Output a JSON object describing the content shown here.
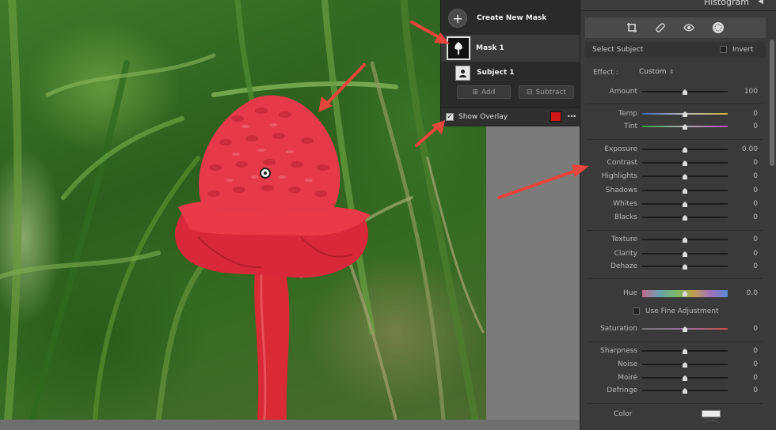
{
  "histogram": {
    "title": "Histogram"
  },
  "mask_panel": {
    "create_new_mask": "Create New Mask",
    "mask_name": "Mask 1",
    "subject_name": "Subject 1",
    "add_label": "Add",
    "subtract_label": "Subtract",
    "show_overlay_label": "Show Overlay",
    "overlay_checked": true,
    "overlay_color": "#d01818",
    "more_label": "•••"
  },
  "panel": {
    "select_subject": "Select Subject",
    "invert_label": "Invert",
    "effect_label": "Effect :",
    "effect_value": "Custom",
    "use_fine_adjustment": "Use Fine Adjustment",
    "color_label": "Color"
  },
  "sliders": [
    {
      "label": "Amount",
      "value": "100",
      "pos": 0.5,
      "style": "plain"
    },
    {
      "label": "Temp",
      "value": "0",
      "pos": 0.5,
      "style": "temp"
    },
    {
      "label": "Tint",
      "value": "0",
      "pos": 0.5,
      "style": "tint"
    },
    {
      "label": "Exposure",
      "value": "0.00",
      "pos": 0.5,
      "style": "plain"
    },
    {
      "label": "Contrast",
      "value": "0",
      "pos": 0.5,
      "style": "plain"
    },
    {
      "label": "Highlights",
      "value": "0",
      "pos": 0.5,
      "style": "plain"
    },
    {
      "label": "Shadows",
      "value": "0",
      "pos": 0.5,
      "style": "plain"
    },
    {
      "label": "Whites",
      "value": "0",
      "pos": 0.5,
      "style": "plain"
    },
    {
      "label": "Blacks",
      "value": "0",
      "pos": 0.5,
      "style": "plain"
    },
    {
      "label": "Texture",
      "value": "0",
      "pos": 0.5,
      "style": "plain"
    },
    {
      "label": "Clarity",
      "value": "0",
      "pos": 0.5,
      "style": "plain"
    },
    {
      "label": "Dehaze",
      "value": "0",
      "pos": 0.5,
      "style": "plain"
    },
    {
      "label": "Hue",
      "value": "0.0",
      "pos": 0.5,
      "style": "hue"
    },
    {
      "label": "Saturation",
      "value": "0",
      "pos": 0.5,
      "style": "saturation"
    },
    {
      "label": "Sharpness",
      "value": "0",
      "pos": 0.5,
      "style": "plain"
    },
    {
      "label": "Noise",
      "value": "0",
      "pos": 0.5,
      "style": "plain"
    },
    {
      "label": "Moiré",
      "value": "0",
      "pos": 0.5,
      "style": "plain"
    },
    {
      "label": "Defringe",
      "value": "0",
      "pos": 0.5,
      "style": "plain"
    }
  ],
  "colors": {
    "annotation_arrow": "#e8453c",
    "flower": "#e3303f",
    "panel_bg": "#3a3a3a"
  }
}
